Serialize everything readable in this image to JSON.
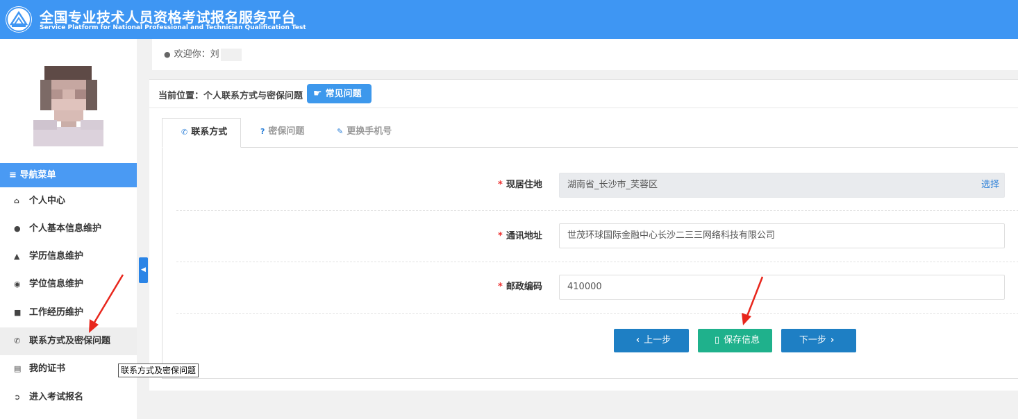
{
  "header": {
    "title_cn": "全国专业技术人员资格考试报名服务平台",
    "title_en": "Service Platform for National Professional and Technician Qualification Test",
    "logo_icon": "pta-logo-icon"
  },
  "sidebar": {
    "nav_title": "导航菜单",
    "items": [
      {
        "label": "个人中心",
        "icon": "home-icon"
      },
      {
        "label": "个人基本信息维护",
        "icon": "user-icon"
      },
      {
        "label": "学历信息维护",
        "icon": "graduation-cap-icon"
      },
      {
        "label": "学位信息维护",
        "icon": "medal-icon"
      },
      {
        "label": "工作经历维护",
        "icon": "briefcase-icon"
      },
      {
        "label": "联系方式及密保问题",
        "icon": "phone-icon",
        "active": true
      },
      {
        "label": "我的证书",
        "icon": "book-icon"
      },
      {
        "label": "进入考试报名",
        "icon": "arrow-circle-icon"
      }
    ],
    "tooltip": "联系方式及密保问题"
  },
  "welcome": {
    "text": "欢迎你：刘"
  },
  "breadcrumb": {
    "text": "当前位置：个人联系方式与密保问题",
    "faq_button": "常见问题"
  },
  "tabs": [
    {
      "label": "联系方式",
      "icon": "phone-icon",
      "active": true
    },
    {
      "label": "密保问题",
      "icon": "question-icon"
    },
    {
      "label": "更换手机号",
      "icon": "pencil-icon"
    }
  ],
  "form": {
    "residence": {
      "label": "现居住地",
      "value": "湖南省_长沙市_芙蓉区",
      "action": "选择"
    },
    "address": {
      "label": "通讯地址",
      "value": "世茂环球国际金融中心长沙二三三网络科技有限公司"
    },
    "postcode": {
      "label": "邮政编码",
      "value": "410000"
    }
  },
  "buttons": {
    "prev": "上一步",
    "save": "保存信息",
    "next": "下一步"
  },
  "colors": {
    "header": "#3e96f3",
    "primary": "#1e7fc4",
    "success": "#1fb18c",
    "annotation": "#e8261c"
  }
}
